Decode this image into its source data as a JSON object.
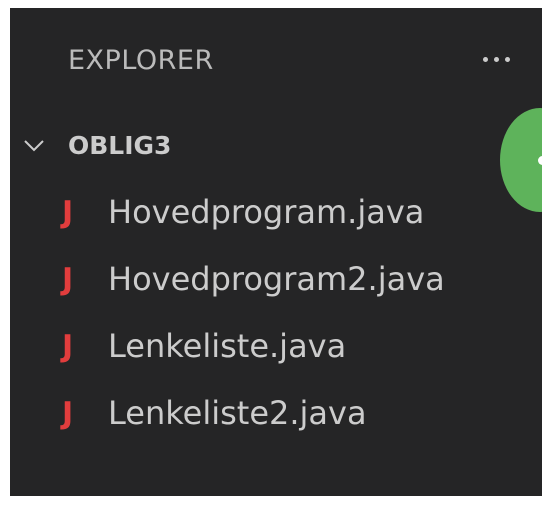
{
  "explorer": {
    "title": "EXPLORER",
    "more_actions_icon": "ellipsis-icon"
  },
  "folder": {
    "name": "OBLIG3",
    "expanded": true,
    "chevron_icon": "chevron-down-icon"
  },
  "files": [
    {
      "label": "Hovedprogram.java",
      "icon": "java-file-icon",
      "icon_glyph": "J"
    },
    {
      "label": "Hovedprogram2.java",
      "icon": "java-file-icon",
      "icon_glyph": "J"
    },
    {
      "label": "Lenkeliste.java",
      "icon": "java-file-icon",
      "icon_glyph": "J"
    },
    {
      "label": "Lenkeliste2.java",
      "icon": "java-file-icon",
      "icon_glyph": "J"
    }
  ],
  "colors": {
    "panel_background": "#252526",
    "text": "#cccccc",
    "java_icon": "#e23d3d",
    "badge": "#5eb35b"
  }
}
